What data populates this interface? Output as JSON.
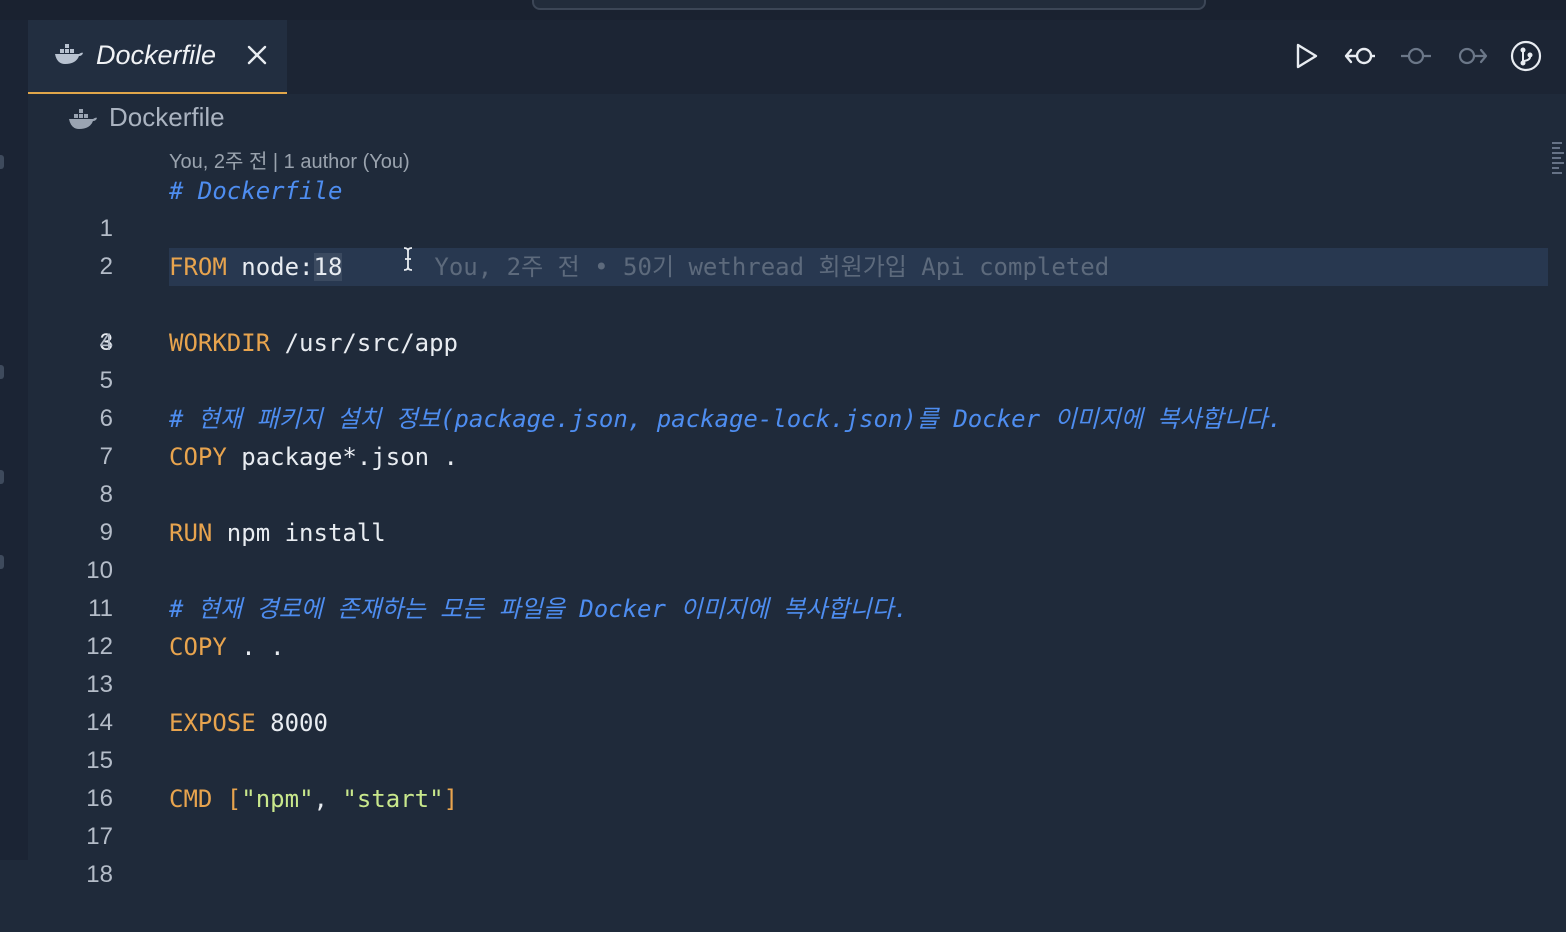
{
  "tab": {
    "title": "Dockerfile"
  },
  "breadcrumb": {
    "label": "Dockerfile"
  },
  "codelens": "You, 2주 전 | 1 author (You)",
  "blame": "You, 2주 전 • 50기 wethread 회원가입 Api completed",
  "toolbar": {
    "icons": [
      "run-icon",
      "previous-change-icon",
      "commit-icon",
      "next-change-icon",
      "git-compare-icon"
    ]
  },
  "lines": [
    {
      "n": "1",
      "c": "# Dockerfile"
    },
    {
      "n": "2",
      "c": ""
    },
    {
      "n": "3",
      "kw": "FROM",
      "rest": " node:",
      "sel": "18"
    },
    {
      "n": "4",
      "c": ""
    },
    {
      "n": "5",
      "kw": "WORKDIR",
      "rest": " /usr/src/app"
    },
    {
      "n": "6",
      "c": ""
    },
    {
      "n": "7",
      "c": "# 현재 패키지 설치 정보(package.json, package-lock.json)를 Docker 이미지에 복사합니다."
    },
    {
      "n": "8",
      "kw": "COPY",
      "rest": " package*.json ."
    },
    {
      "n": "9",
      "c": ""
    },
    {
      "n": "10",
      "kw": "RUN",
      "rest": " npm install"
    },
    {
      "n": "11",
      "c": ""
    },
    {
      "n": "12",
      "c": "# 현재 경로에 존재하는 모든 파일을 Docker 이미지에 복사합니다."
    },
    {
      "n": "13",
      "kw": "COPY",
      "rest": " . ."
    },
    {
      "n": "14",
      "c": ""
    },
    {
      "n": "15",
      "kw": "EXPOSE",
      "rest": " 8000"
    },
    {
      "n": "16",
      "c": ""
    },
    {
      "n": "17",
      "kw": "CMD",
      "b1": " [",
      "s1": "\"npm\"",
      "mid": ", ",
      "s2": "\"start\"",
      "b2": "]"
    },
    {
      "n": "18",
      "c": ""
    }
  ],
  "colors": {
    "background": "#1f2a3a",
    "keyword": "#e8a44e",
    "comment": "#4e8df0",
    "string": "#c9e88c",
    "tab_accent": "#e0a64a"
  }
}
